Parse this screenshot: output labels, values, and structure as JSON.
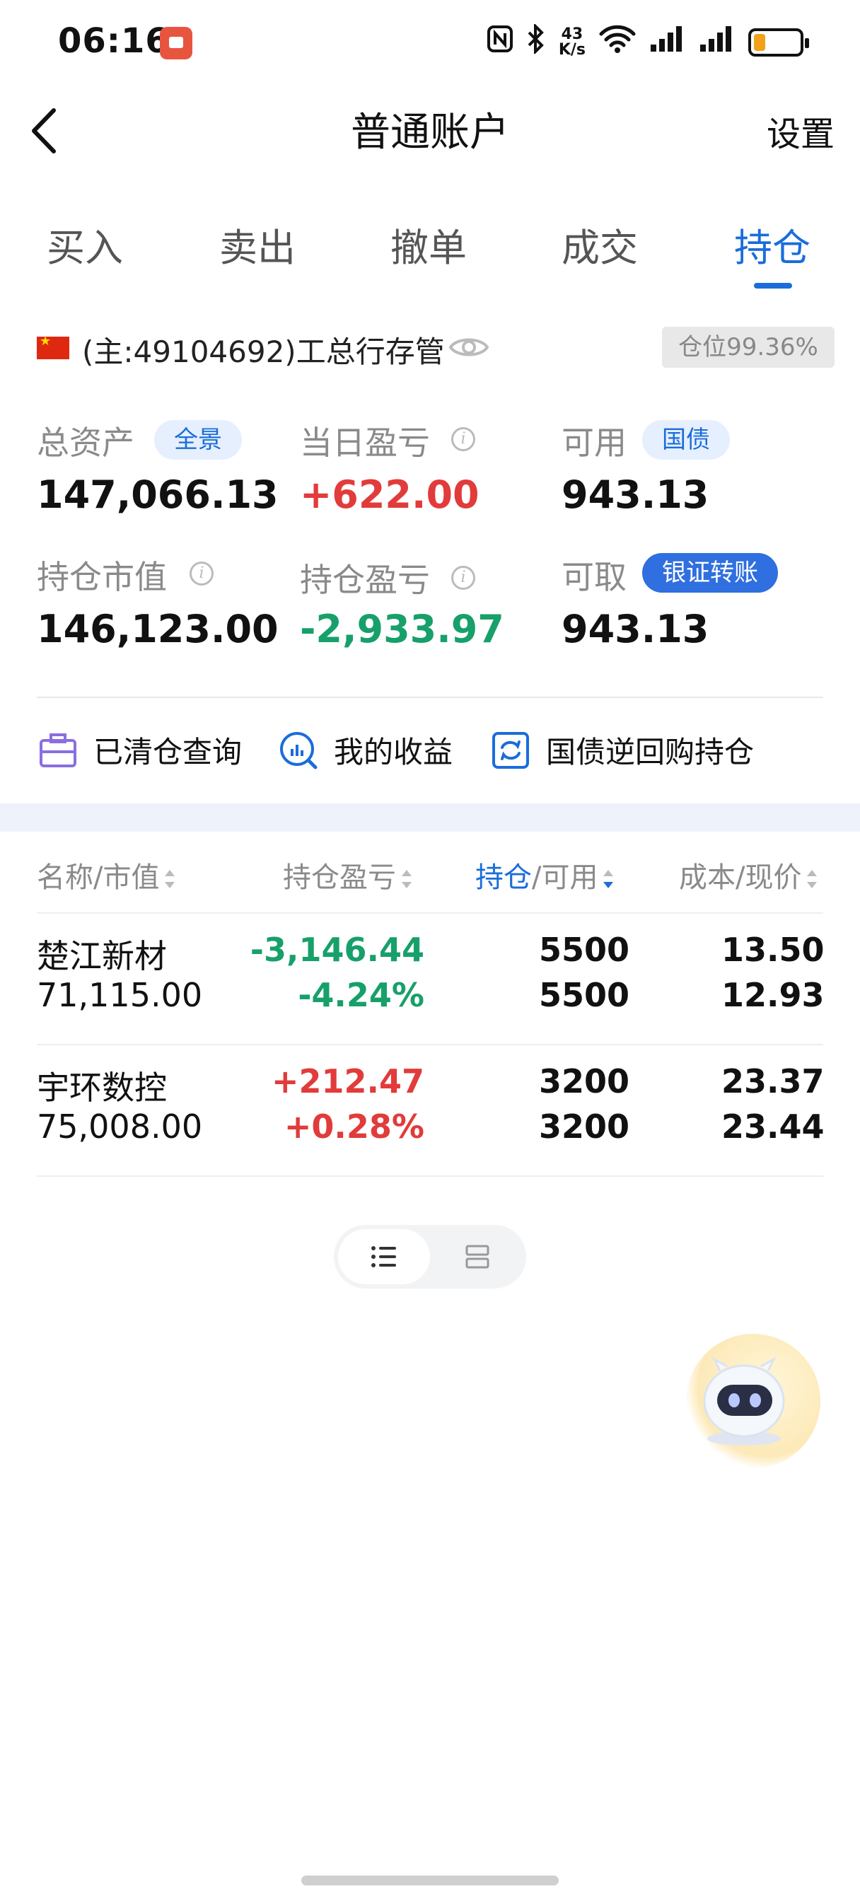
{
  "status_bar": {
    "time": "06:16",
    "net_speed_top": "43",
    "net_speed_bottom": "K/s"
  },
  "header": {
    "title": "普通账户",
    "settings_label": "设置"
  },
  "tabs": [
    {
      "label": "买入"
    },
    {
      "label": "卖出"
    },
    {
      "label": "撤单"
    },
    {
      "label": "成交"
    },
    {
      "label": "持仓"
    }
  ],
  "active_tab": "持仓",
  "account": {
    "label": "(主:49104692)工总行存管",
    "position_ratio": "仓位99.36%"
  },
  "summary": {
    "total_assets_label": "总资产",
    "total_assets_chip": "全景",
    "total_assets": "147,066.13",
    "daily_pnl_label": "当日盈亏",
    "daily_pnl": "+622.00",
    "available_label": "可用",
    "available_chip": "国债",
    "available": "943.13",
    "market_value_label": "持仓市值",
    "market_value": "146,123.00",
    "position_pnl_label": "持仓盈亏",
    "position_pnl": "-2,933.97",
    "withdrawable_label": "可取",
    "withdrawable_chip": "银证转账",
    "withdrawable": "943.13"
  },
  "quick_actions": [
    {
      "label": "已清仓查询",
      "icon": "briefcase-icon"
    },
    {
      "label": "我的收益",
      "icon": "chart-circle-icon"
    },
    {
      "label": "国债逆回购持仓",
      "icon": "refresh-square-icon"
    }
  ],
  "table": {
    "headers": [
      "名称/市值",
      "持仓盈亏",
      "持仓",
      "/可用",
      "成本/现价"
    ],
    "rows": [
      {
        "name": "楚江新材",
        "market_value": "71,115.00",
        "pnl": "-3,146.44",
        "pnl_pct": "-4.24%",
        "position": "5500",
        "available": "5500",
        "cost": "13.502",
        "price": "12.930"
      },
      {
        "name": "宇环数控",
        "market_value": "75,008.00",
        "pnl": "+212.47",
        "pnl_pct": "+0.28%",
        "position": "3200",
        "available": "3200",
        "cost": "23.374",
        "price": "23.440"
      }
    ]
  },
  "colors": {
    "accent": "#1a6ddb",
    "loss": "#17a06a",
    "gain": "#e23b3b"
  }
}
